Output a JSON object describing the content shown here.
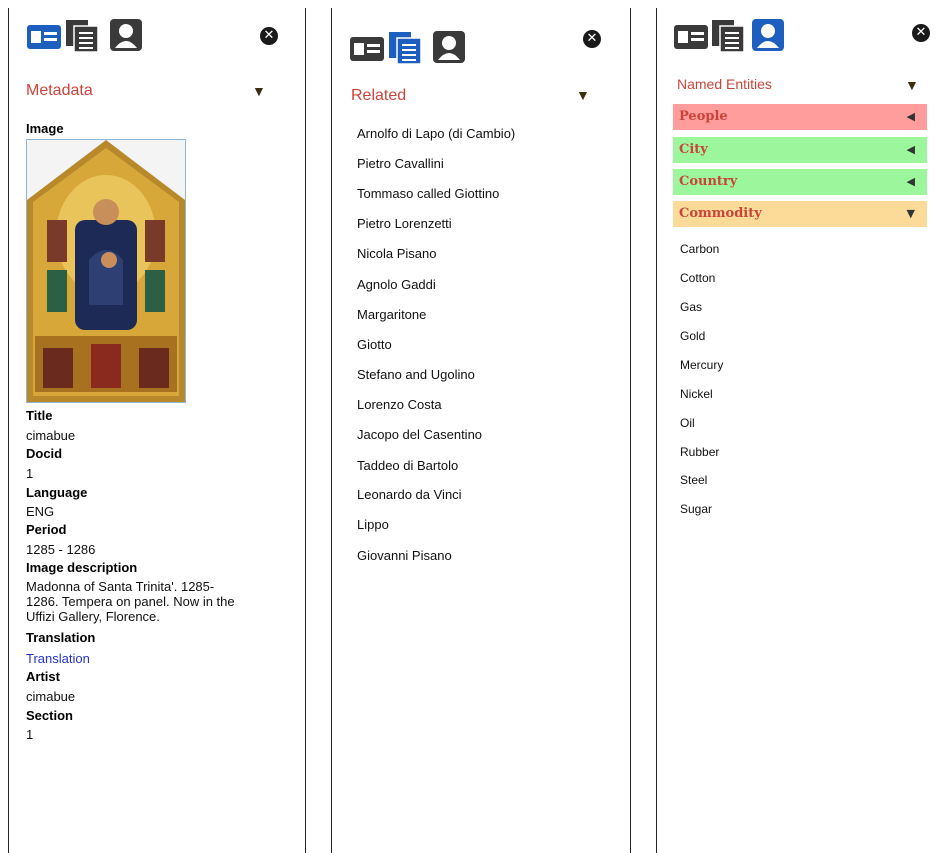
{
  "panel_metadata": {
    "section_title": "Metadata",
    "image_label": "Image",
    "fields": [
      {
        "label": "Title",
        "value": "cimabue"
      },
      {
        "label": "Docid",
        "value": "1"
      },
      {
        "label": "Language",
        "value": "ENG"
      },
      {
        "label": "Period",
        "value": "1285 - 1286"
      },
      {
        "label": "Image description",
        "value_lines": [
          "Madonna of Santa Trinita'. 1285-",
          "1286. Tempera on panel. Now in the",
          "Uffizi Gallery, Florence."
        ]
      },
      {
        "label": "Translation",
        "value": "Translation"
      },
      {
        "label": "Artist",
        "value": "cimabue"
      },
      {
        "label": "Section",
        "value": "1"
      }
    ]
  },
  "panel_related": {
    "section_title": "Related",
    "items": [
      "Arnolfo di Lapo (di Cambio)",
      "Pietro Cavallini",
      "Tommaso called Giottino",
      "Pietro Lorenzetti",
      "Nicola Pisano",
      "Agnolo Gaddi",
      "Margaritone",
      "Giotto",
      "Stefano and Ugolino",
      "Lorenzo Costa",
      "Jacopo del Casentino",
      "Taddeo di Bartolo",
      "Leonardo da Vinci",
      "Lippo",
      "Giovanni Pisano"
    ]
  },
  "panel_entities": {
    "section_title": "Named Entities",
    "categories": [
      {
        "label": "People",
        "color": "#ff9c9c",
        "expanded": false
      },
      {
        "label": "City",
        "color": "#9cf79c",
        "expanded": false
      },
      {
        "label": "Country",
        "color": "#9cf79c",
        "expanded": false
      },
      {
        "label": "Commodity",
        "color": "#fcdb98",
        "expanded": true
      }
    ],
    "commodities": [
      "Carbon",
      "Cotton",
      "Gas",
      "Gold",
      "Mercury",
      "Nickel",
      "Oil",
      "Rubber",
      "Steel",
      "Sugar"
    ]
  },
  "icons": {
    "metadata": "id-card-icon",
    "related": "documents-icon",
    "entities": "person-icon",
    "close": "close-icon",
    "active_color": "#1d5fbf",
    "inactive_color": "#3a3a3a"
  },
  "symbols": {
    "close": "✕",
    "collapsed": "◀",
    "expanded": "▼"
  }
}
